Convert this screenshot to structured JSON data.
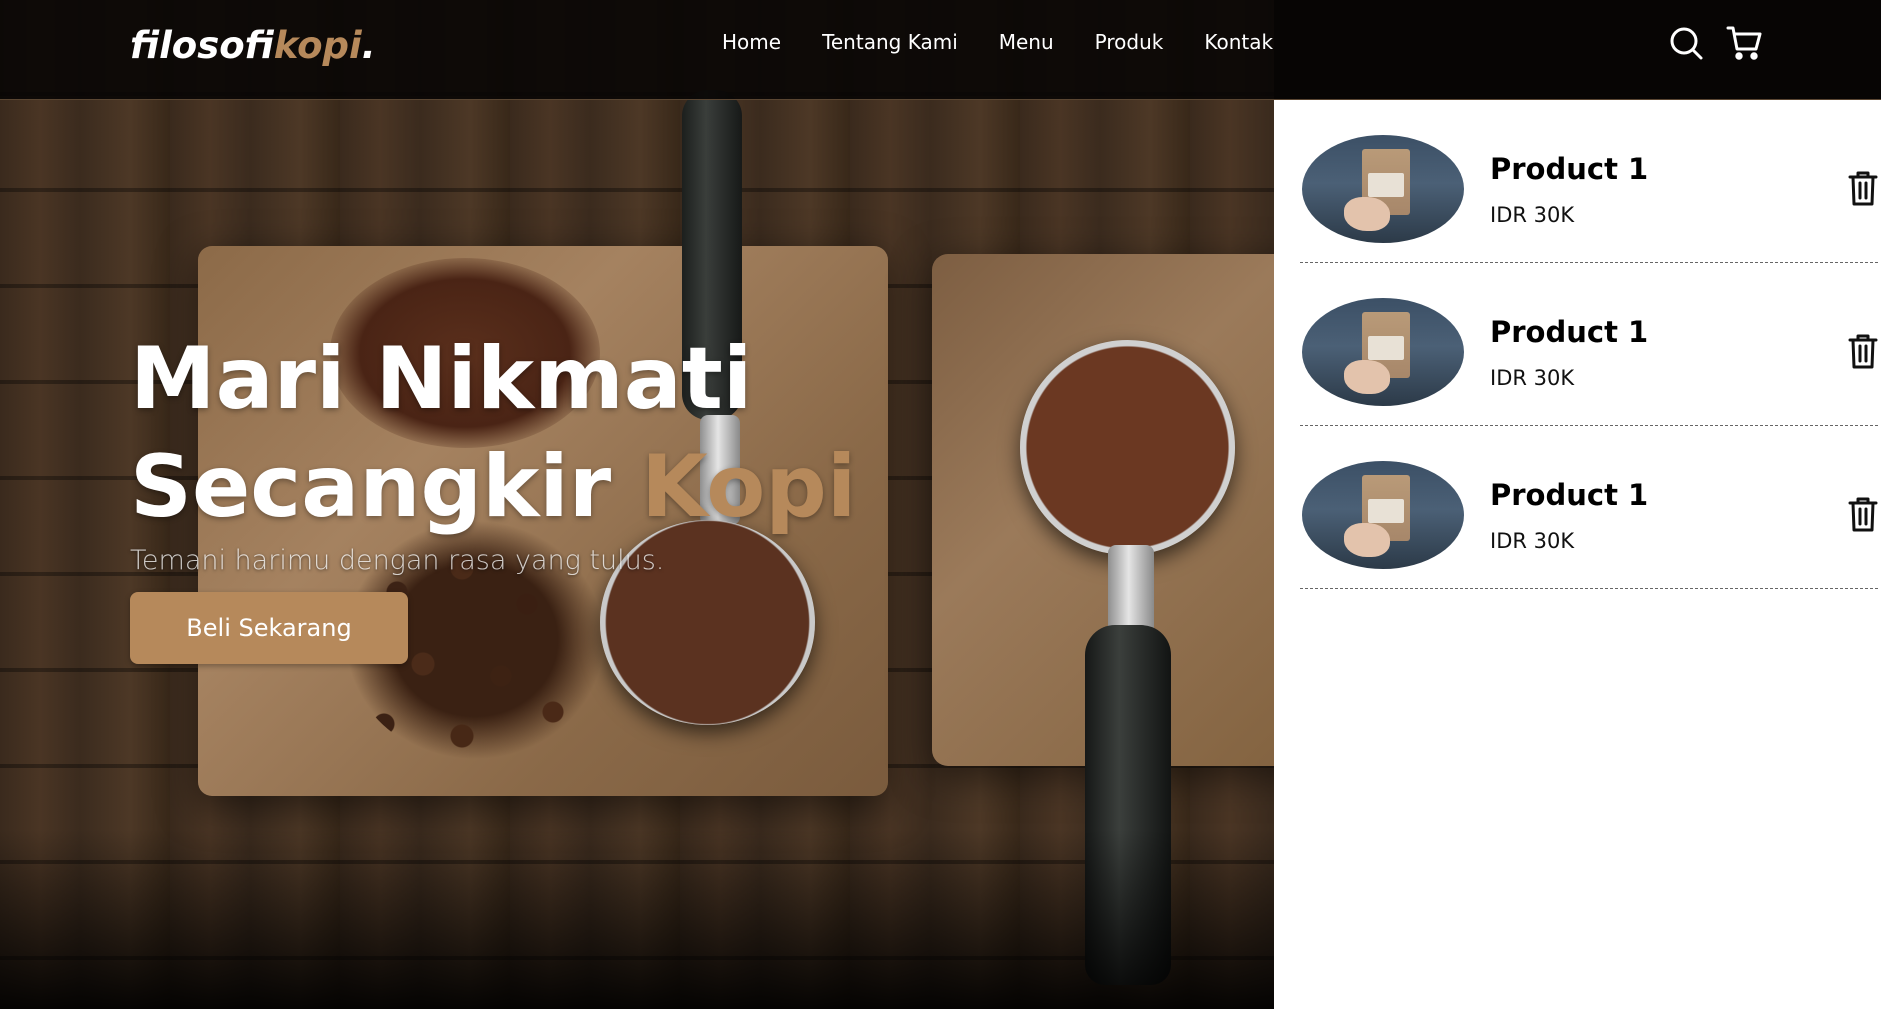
{
  "brand": {
    "logo_main": "filosofi",
    "logo_accent": "kopi",
    "logo_dot": ".",
    "accent_color": "#b6895b"
  },
  "nav": {
    "links": [
      "Home",
      "Tentang Kami",
      "Menu",
      "Produk",
      "Kontak"
    ],
    "icons": [
      "search-icon",
      "shopping-cart-icon"
    ]
  },
  "hero": {
    "title_line1": "Mari Nikmati",
    "title_line2_plain": "Secangkir ",
    "title_line2_accent": "Kopi",
    "subtitle": "Temani harimu dengan rasa yang tulus.",
    "cta_label": "Beli Sekarang"
  },
  "cart": {
    "items": [
      {
        "name": "Product 1",
        "price": "IDR 30K",
        "action_icon": "trash-icon"
      },
      {
        "name": "Product 1",
        "price": "IDR 30K",
        "action_icon": "trash-icon"
      },
      {
        "name": "Product 1",
        "price": "IDR 30K",
        "action_icon": "trash-icon"
      }
    ]
  }
}
